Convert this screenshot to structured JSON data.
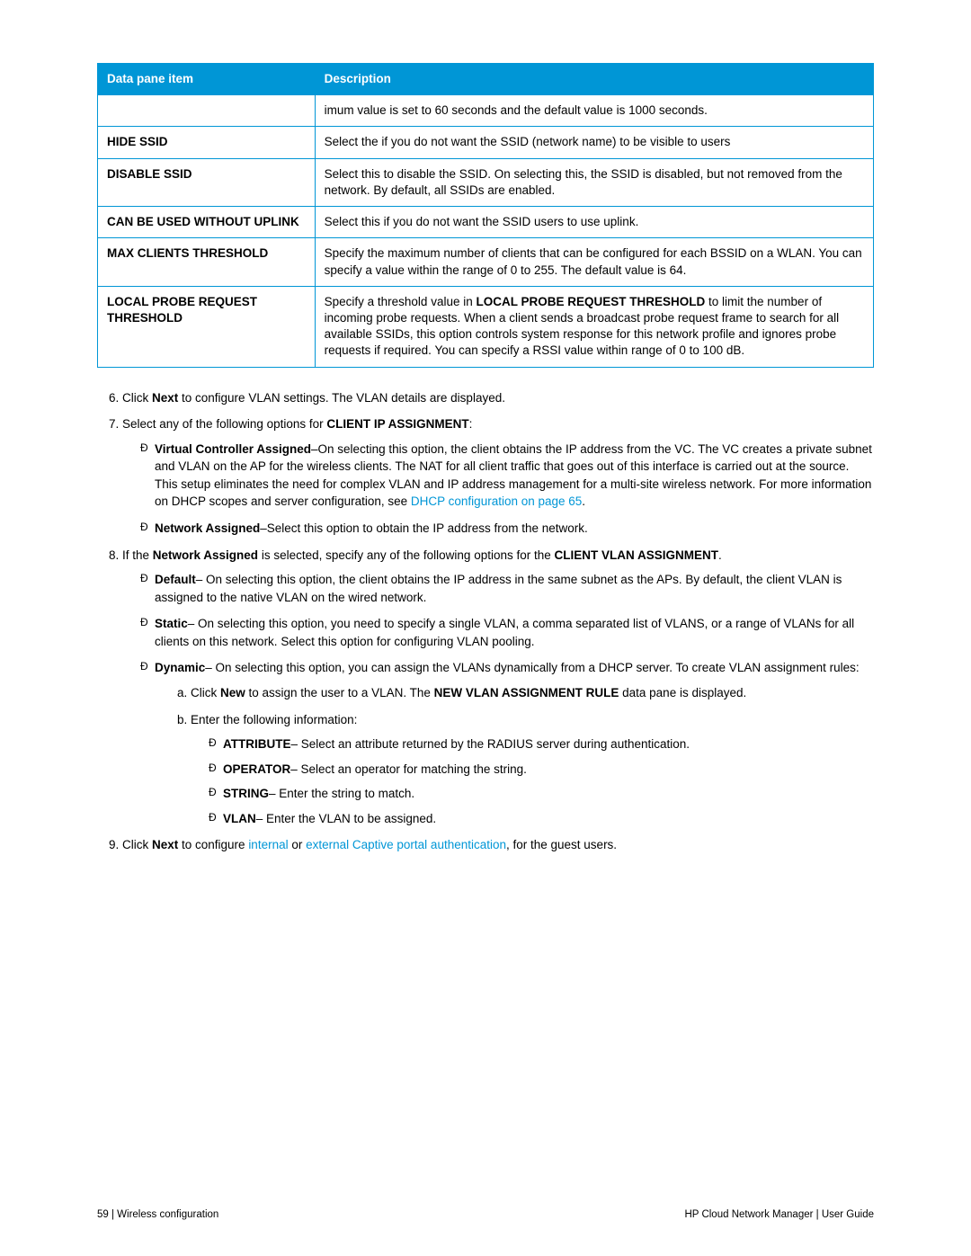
{
  "table": {
    "header1": "Data pane item",
    "header2": "Description",
    "rows": [
      {
        "label": "",
        "desc": "imum value is set to 60 seconds and the default value is 1000 seconds."
      },
      {
        "label": "HIDE SSID",
        "desc": "Select the if you do not want the SSID (network name) to be visible to users"
      },
      {
        "label": "DISABLE SSID",
        "desc": "Select this to disable the SSID. On selecting this, the SSID is disabled, but not removed from the network. By default, all SSIDs are enabled."
      },
      {
        "label": "CAN BE USED WITHOUT UPLINK",
        "desc": "Select this if you do not want the SSID users to use uplink."
      },
      {
        "label": "MAX CLIENTS THRESHOLD",
        "desc": "Specify the maximum number of clients that can be configured for each BSSID on a WLAN. You can specify a value within the range of 0 to 255. The default value is 64."
      },
      {
        "label": "LOCAL PROBE REQUEST THRESHOLD",
        "desc_pre": "Specify a threshold value in ",
        "desc_bold": "LOCAL PROBE REQUEST THRESHOLD",
        "desc_post": " to limit the number of incoming probe requests. When a client sends a broadcast probe request frame to search for all available SSIDs, this option controls system response for this network profile and ignores probe requests if required. You can specify a RSSI value within range of 0 to 100 dB."
      }
    ]
  },
  "step6_pre": "Click ",
  "step6_b": "Next",
  "step6_post": " to configure VLAN settings. The VLAN details are displayed.",
  "step7_pre": "Select any of the following options for ",
  "step7_b": "CLIENT IP ASSIGNMENT",
  "step7_post": ":",
  "step7_vc_b": "Virtual Controller Assigned",
  "step7_vc_txt1": "–On selecting this option, the client obtains the IP address from the VC. The VC creates a private subnet and VLAN on the AP for the wireless clients. The NAT for all client traffic that goes out of this interface is carried out at the source. This setup eliminates the need for complex VLAN and IP address management for a multi-site wireless network. For more information on DHCP scopes and server configuration, see ",
  "step7_vc_link": "DHCP configuration on page 65",
  "step7_vc_txt2": ".",
  "step7_na_b": "Network Assigned",
  "step7_na_txt": "–Select this option to obtain the IP address from the network.",
  "step8_pre": "If the ",
  "step8_b1": "Network Assigned",
  "step8_mid": " is selected, specify any of the following options for the ",
  "step8_b2": "CLIENT VLAN ASSIGNMENT",
  "step8_post": ".",
  "step8_def_b": "Default",
  "step8_def_txt": "– On selecting this option, the client obtains the IP address in the same subnet as the APs. By default, the client VLAN is assigned to the native VLAN on the wired network.",
  "step8_sta_b": "Static",
  "step8_sta_txt": "– On selecting this option, you need to specify a single VLAN, a comma separated list of VLANS, or a range of VLANs for all clients on this network. Select this option for configuring VLAN pooling.",
  "step8_dyn_b": "Dynamic",
  "step8_dyn_txt": "– On selecting this option, you can assign the VLANs dynamically from a DHCP server. To create VLAN assignment rules:",
  "step8a_pre": "Click ",
  "step8a_b1": "New",
  "step8a_mid": " to assign the user to a VLAN. The ",
  "step8a_b2": "NEW VLAN ASSIGNMENT RULE",
  "step8a_post": " data pane is displayed.",
  "step8b": "Enter the following information:",
  "attr_b": "ATTRIBUTE",
  "attr_txt": "– Select an attribute returned by the RADIUS server during authentication.",
  "op_b": "OPERATOR",
  "op_txt": "– Select an operator for matching the string.",
  "str_b": "STRING",
  "str_txt": "– Enter the string to match.",
  "vlan_b": "VLAN",
  "vlan_txt": "– Enter the VLAN to be assigned.",
  "step9_pre": "Click ",
  "step9_b": "Next",
  "step9_mid1": " to configure ",
  "step9_link1": "internal",
  "step9_mid2": " or ",
  "step9_link2": "external Captive portal authentication",
  "step9_post": ", for the guest users.",
  "footer_left": "59 | Wireless configuration",
  "footer_right": "HP Cloud Network Manager | User Guide"
}
